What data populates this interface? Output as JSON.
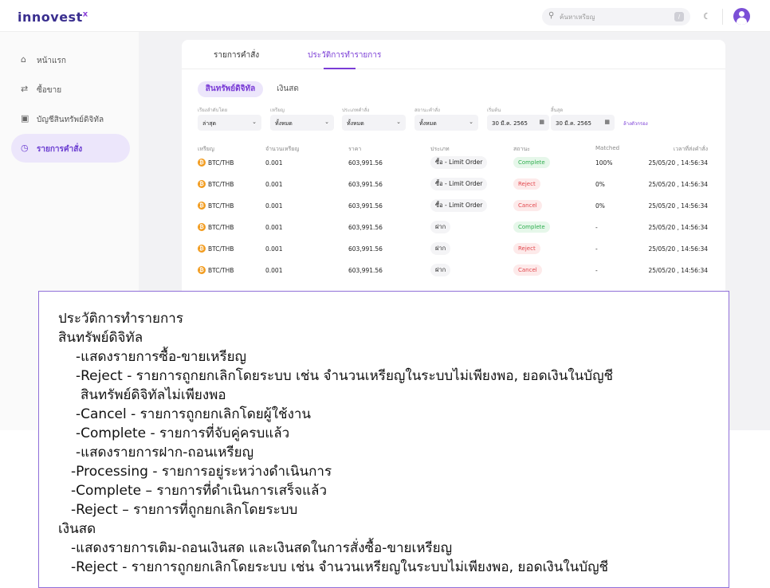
{
  "header": {
    "logo": "innovest",
    "logo_mark": "x",
    "search_placeholder": "ค้นหาเหรียญ",
    "search_shortcut": "/"
  },
  "sidebar": {
    "items": [
      {
        "label": "หน้าแรก",
        "icon": "home-icon"
      },
      {
        "label": "ซื้อขาย",
        "icon": "swap-icon"
      },
      {
        "label": "บัญชีสินทรัพย์ดิจิทัล",
        "icon": "wallet-icon"
      },
      {
        "label": "รายการคำสั่ง",
        "icon": "clock-icon",
        "active": true
      }
    ]
  },
  "tabs": [
    {
      "label": "รายการคำสั่ง"
    },
    {
      "label": "ประวัติการทำรายการ",
      "active": true
    }
  ],
  "subtabs": [
    {
      "label": "สินทรัพย์ดิจิทัล",
      "active": true
    },
    {
      "label": "เงินสด"
    }
  ],
  "filters": [
    {
      "label": "เรียงลำดับโดย",
      "value": "ล่าสุด"
    },
    {
      "label": "เหรียญ",
      "value": "ทั้งหมด"
    },
    {
      "label": "ประเภทคำสั่ง",
      "value": "ทั้งหมด"
    },
    {
      "label": "สถานะคำสั่ง",
      "value": "ทั้งหมด"
    },
    {
      "label": "เริ่มต้น",
      "value": "30 มี.ค. 2565"
    },
    {
      "label": "สิ้นสุด",
      "value": "30 มี.ค. 2565"
    }
  ],
  "clear_filter": "ล้างตัวกรอง",
  "table": {
    "headers": [
      "เหรียญ",
      "จำนวนเหรียญ",
      "ราคา",
      "ประเภท",
      "สถานะ",
      "Matched",
      "เวลาที่ส่งคำสั่ง"
    ],
    "rows": [
      {
        "coin": "BTC/THB",
        "amount": "0.001",
        "price": "603,991.56",
        "type": "ซื้อ - Limit Order",
        "status": "Complete",
        "status_kind": "complete",
        "matched": "100%",
        "time": "25/05/20 , 14:56:34"
      },
      {
        "coin": "BTC/THB",
        "amount": "0.001",
        "price": "603,991.56",
        "type": "ซื้อ - Limit Order",
        "status": "Reject",
        "status_kind": "reject",
        "matched": "0%",
        "time": "25/05/20 , 14:56:34"
      },
      {
        "coin": "BTC/THB",
        "amount": "0.001",
        "price": "603,991.56",
        "type": "ซื้อ - Limit Order",
        "status": "Cancel",
        "status_kind": "cancel",
        "matched": "0%",
        "time": "25/05/20 , 14:56:34"
      },
      {
        "coin": "BTC/THB",
        "amount": "0.001",
        "price": "603,991.56",
        "type": "ฝาก",
        "status": "Complete",
        "status_kind": "complete",
        "matched": "-",
        "time": "25/05/20 , 14:56:34"
      },
      {
        "coin": "BTC/THB",
        "amount": "0.001",
        "price": "603,991.56",
        "type": "ฝาก",
        "status": "Reject",
        "status_kind": "reject",
        "matched": "-",
        "time": "25/05/20 , 14:56:34"
      },
      {
        "coin": "BTC/THB",
        "amount": "0.001",
        "price": "603,991.56",
        "type": "ฝาก",
        "status": "Cancel",
        "status_kind": "cancel",
        "matched": "-",
        "time": "25/05/20 , 14:56:34"
      }
    ]
  },
  "annotation": {
    "lines": [
      "ประวัติการทำรายการ",
      "สินทรัพย์ดิจิทัล",
      "-แสดงรายการซื้อ-ขายเหรียญ",
      "-Reject - รายการถูกยกเลิกโดยระบบ เช่น จำนวนเหรียญในระบบไม่เพียงพอ, ยอดเงินในบัญชี",
      "สินทรัพย์ดิจิทัลไม่เพียงพอ",
      "-Cancel - รายการถูกยกเลิกโดยผู้ใช้งาน",
      "-Complete - รายการที่จับคู่ครบแล้ว",
      "-แสดงรายการฝาก-ถอนเหรียญ",
      "-Processing - รายการอยู่ระหว่างดำเนินการ",
      "-Complete – รายการที่ดำเนินการเสร็จแล้ว",
      "-Reject – รายการที่ถูกยกเลิกโดยระบบ",
      "เงินสด",
      "-แสดงรายการเติม-ถอนเงินสด และเงินสดในการสั่งซื้อ-ขายเหรียญ",
      "-Reject - รายการถูกยกเลิกโดยระบบ เช่น จำนวนเหรียญในระบบไม่เพียงพอ, ยอดเงินในบัญชี"
    ]
  },
  "colors": {
    "accent": "#7a3cd6",
    "complete": "#2fae4f",
    "reject": "#e2474d",
    "coin": "#f29c1f"
  }
}
